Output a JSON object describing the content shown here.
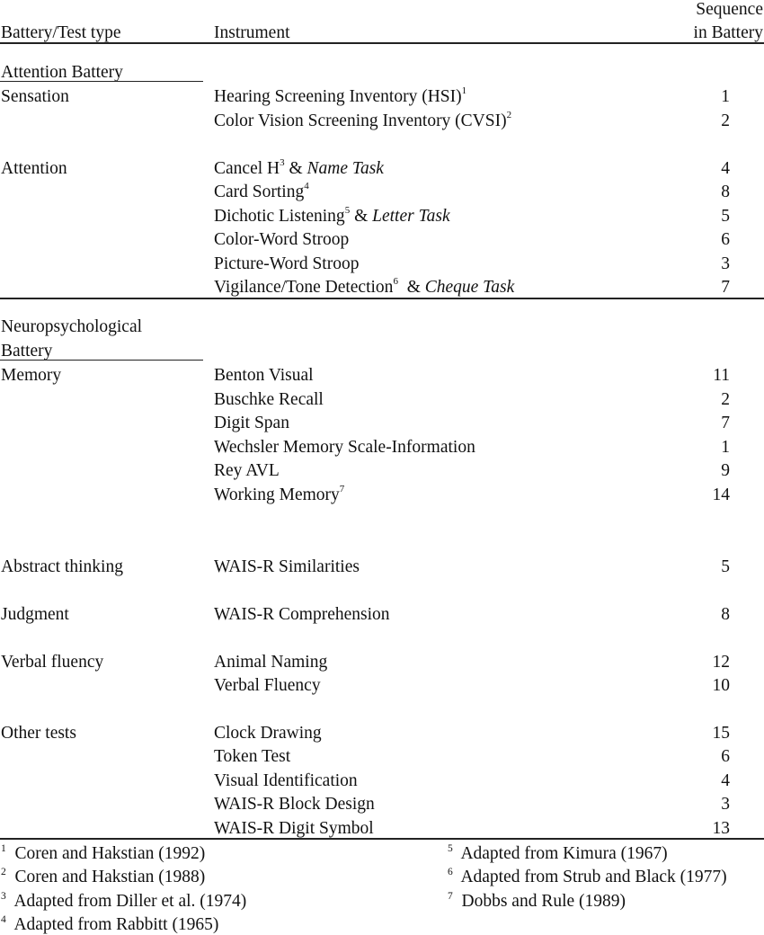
{
  "header": {
    "col1": "Battery/Test type",
    "col2": "Instrument",
    "col3_line1": "Sequence",
    "col3_line2": "in Battery"
  },
  "sections": [
    {
      "battery": "Attention Battery",
      "groups": [
        {
          "type": "Sensation",
          "rows": [
            {
              "instrument": "Hearing Screening Inventory (HSI)",
              "sup": "1",
              "task": "",
              "seq": "1"
            },
            {
              "instrument": "Color Vision Screening Inventory (CVSI)",
              "sup": "2",
              "task": "",
              "seq": "2"
            }
          ]
        },
        {
          "type": "Attention",
          "rows": [
            {
              "instrument": "Cancel H",
              "sup": "3",
              "connector": " & ",
              "task": "Name Task",
              "seq": "4"
            },
            {
              "instrument": "Card Sorting",
              "sup": "4",
              "task": "",
              "seq": "8"
            },
            {
              "instrument": "Dichotic Listening",
              "sup": "5",
              "connector": " & ",
              "task": "Letter Task",
              "seq": "5"
            },
            {
              "instrument": "Color-Word Stroop",
              "sup": "",
              "task": "",
              "seq": "6"
            },
            {
              "instrument": "Picture-Word Stroop",
              "sup": "",
              "task": "",
              "seq": "3"
            },
            {
              "instrument": "Vigilance/Tone Detection",
              "sup": "6",
              "connector": "  & ",
              "task": "Cheque Task",
              "seq": "7"
            }
          ]
        }
      ]
    },
    {
      "battery_line1": "Neuropsychological",
      "battery_line2": "Battery",
      "groups": [
        {
          "type": "Memory",
          "rows": [
            {
              "instrument": "Benton Visual",
              "sup": "",
              "seq": "11"
            },
            {
              "instrument": "Buschke Recall",
              "sup": "",
              "seq": "2"
            },
            {
              "instrument": "Digit Span",
              "sup": "",
              "seq": "7"
            },
            {
              "instrument": "Wechsler Memory Scale-Information",
              "sup": "",
              "seq": "1"
            },
            {
              "instrument": "Rey AVL",
              "sup": "",
              "seq": "9"
            },
            {
              "instrument": "Working Memory",
              "sup": "7",
              "seq": "14"
            }
          ]
        },
        {
          "type": "Abstract thinking",
          "rows": [
            {
              "instrument": "WAIS-R Similarities",
              "sup": "",
              "seq": "5"
            }
          ]
        },
        {
          "type": "Judgment",
          "rows": [
            {
              "instrument": "WAIS-R Comprehension",
              "sup": "",
              "seq": "8"
            }
          ]
        },
        {
          "type": "Verbal fluency",
          "rows": [
            {
              "instrument": "Animal Naming",
              "sup": "",
              "seq": "12"
            },
            {
              "instrument": "Verbal Fluency",
              "sup": "",
              "seq": "10"
            }
          ]
        },
        {
          "type": "Other tests",
          "rows": [
            {
              "instrument": "Clock Drawing",
              "sup": "",
              "seq": "15"
            },
            {
              "instrument": "Token Test",
              "sup": "",
              "seq": "6"
            },
            {
              "instrument": "Visual Identification",
              "sup": "",
              "seq": "4"
            },
            {
              "instrument": "WAIS-R Block Design",
              "sup": "",
              "seq": "3"
            },
            {
              "instrument": "WAIS-R Digit Symbol",
              "sup": "",
              "seq": "13"
            }
          ]
        }
      ]
    }
  ],
  "footnotes": [
    {
      "num": "1",
      "text": "Coren and Hakstian (1992)"
    },
    {
      "num": "2",
      "text": "Coren and Hakstian (1988)"
    },
    {
      "num": "3",
      "text": "Adapted from Diller et al. (1974)"
    },
    {
      "num": "4",
      "text": "Adapted from Rabbitt (1965)"
    },
    {
      "num": "5",
      "text": "Adapted from Kimura (1967)"
    },
    {
      "num": "6",
      "text": "Adapted from Strub and Black (1977)"
    },
    {
      "num": "7",
      "text": "Dobbs and Rule (1989)"
    }
  ]
}
